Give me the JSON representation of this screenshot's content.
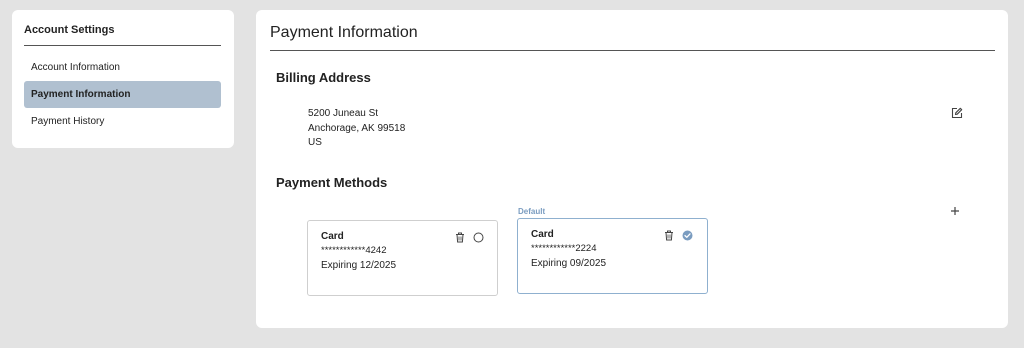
{
  "sidebar": {
    "title": "Account Settings",
    "items": [
      {
        "label": "Account Information",
        "active": false
      },
      {
        "label": "Payment Information",
        "active": true
      },
      {
        "label": "Payment History",
        "active": false
      }
    ]
  },
  "main": {
    "title": "Payment Information",
    "billing": {
      "heading": "Billing Address",
      "line1": "5200 Juneau St",
      "line2": "Anchorage, AK 99518",
      "line3": "US",
      "edit_icon": "edit-icon"
    },
    "payment_methods": {
      "heading": "Payment Methods",
      "add_icon": "plus-icon",
      "default_label": "Default",
      "cards": [
        {
          "title": "Card",
          "number": "************4242",
          "expiry": "Expiring 12/2025",
          "is_default": false
        },
        {
          "title": "Card",
          "number": "************2224",
          "expiry": "Expiring 09/2025",
          "is_default": true
        }
      ]
    }
  },
  "colors": {
    "background": "#e3e3e3",
    "active_nav": "#b0c0d0",
    "default_accent": "#7a9cc0",
    "default_border": "#8fb0cf"
  }
}
